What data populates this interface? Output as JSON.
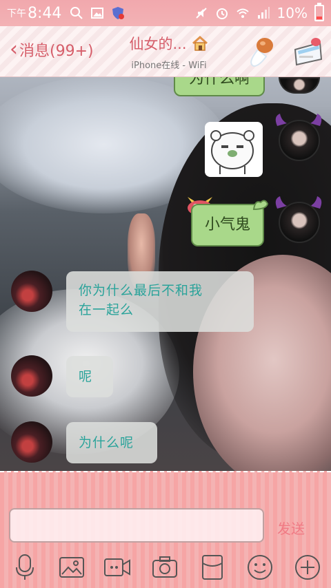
{
  "status_bar": {
    "time_prefix": "下午",
    "time": "8:44",
    "battery_pct": "10%",
    "icons_left": [
      "search-icon",
      "gallery-icon",
      "shield-icon"
    ],
    "icons_right": [
      "mute-icon",
      "alarm-icon",
      "wifi-icon",
      "signal-icon",
      "battery-icon"
    ]
  },
  "header": {
    "back_label": "消息(99+)",
    "title": "仙女的...",
    "subtitle": "iPhone在线 - WiFi"
  },
  "messages": [
    {
      "side": "right",
      "type": "text",
      "text": "为什么啊",
      "partial": true
    },
    {
      "side": "right",
      "type": "sticker",
      "sticker": "bear-sticker"
    },
    {
      "side": "right",
      "type": "text",
      "text": "小气鬼"
    },
    {
      "side": "left",
      "type": "text",
      "text_line1": "你为什么最后不和我",
      "text_line2": "在一起么"
    },
    {
      "side": "left",
      "type": "text",
      "text": "呢"
    },
    {
      "side": "left",
      "type": "text",
      "text": "为什么呢"
    }
  ],
  "composer": {
    "input_value": "",
    "send_label": "发送",
    "tools": [
      "microphone-icon",
      "image-icon",
      "video-call-icon",
      "camera-icon",
      "red-packet-icon",
      "emoji-icon",
      "plus-icon"
    ]
  },
  "colors": {
    "accent": "#d65e6a",
    "status_bar_bg": "#f1a8ad",
    "green_bubble": "#a9d88a",
    "grey_bubble_text": "#2aa39a",
    "send": "#f07a84"
  }
}
